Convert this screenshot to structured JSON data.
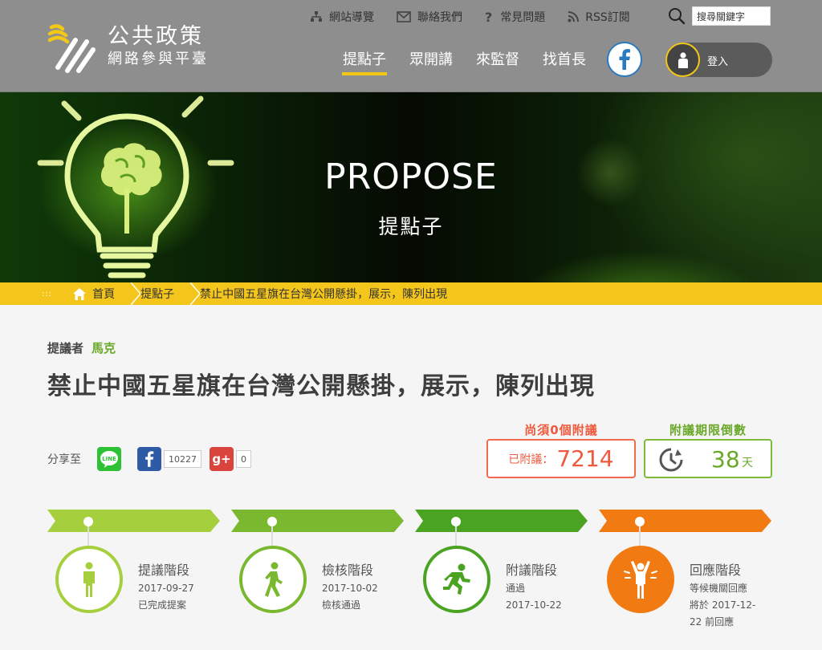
{
  "site": {
    "logo_line1": "公共政策",
    "logo_line2": "網路參與平臺"
  },
  "utility": {
    "sitemap": "網站導覽",
    "contact": "聯絡我們",
    "faq": "常見問題",
    "rss": "RSS訂閱",
    "search_value": "搜尋關鍵字"
  },
  "nav": {
    "items": [
      "提點子",
      "眾開講",
      "來監督",
      "找首長"
    ],
    "active": "提點子"
  },
  "login": {
    "label": "登入"
  },
  "banner": {
    "title": "PROPOSE",
    "subtitle": "提點子"
  },
  "breadcrumb": {
    "items": [
      "首頁",
      "提點子",
      "禁止中國五星旗在台灣公開懸掛，展示，陳列出現"
    ]
  },
  "proposal": {
    "proposer_label": "提議者",
    "proposer_name": "馬克",
    "title": "禁止中國五星旗在台灣公開懸掛，展示，陳列出現"
  },
  "share": {
    "label": "分享至",
    "line_label": "LINE",
    "facebook_count": "10227",
    "gplus_count": "0"
  },
  "signatures": {
    "need_label": "尚須0個附議",
    "current_label": "已附議：",
    "current_value": "7214"
  },
  "countdown": {
    "label": "附議期限倒數",
    "value": "38",
    "unit": "天"
  },
  "stages": [
    {
      "name": "提議階段",
      "line1": "2017-09-27",
      "line2": "已完成提案",
      "line3": "",
      "color": "#a6cf3d"
    },
    {
      "name": "檢核階段",
      "line1": "2017-10-02",
      "line2": "檢核通過",
      "line3": "",
      "color": "#7ab830"
    },
    {
      "name": "附議階段",
      "line1": "通過",
      "line2": "2017-10-22",
      "line3": "",
      "color": "#4aa422"
    },
    {
      "name": "回應階段",
      "line1": "等候機關回應",
      "line2": "將於 2017-12-",
      "line3": "22 前回應",
      "color": "#f27a12"
    }
  ],
  "colors": {
    "header_bg": "#8e8e8e",
    "accent_yellow": "#f4c51a",
    "signature_red": "#ef5a3e",
    "countdown_green": "#6aa829"
  }
}
